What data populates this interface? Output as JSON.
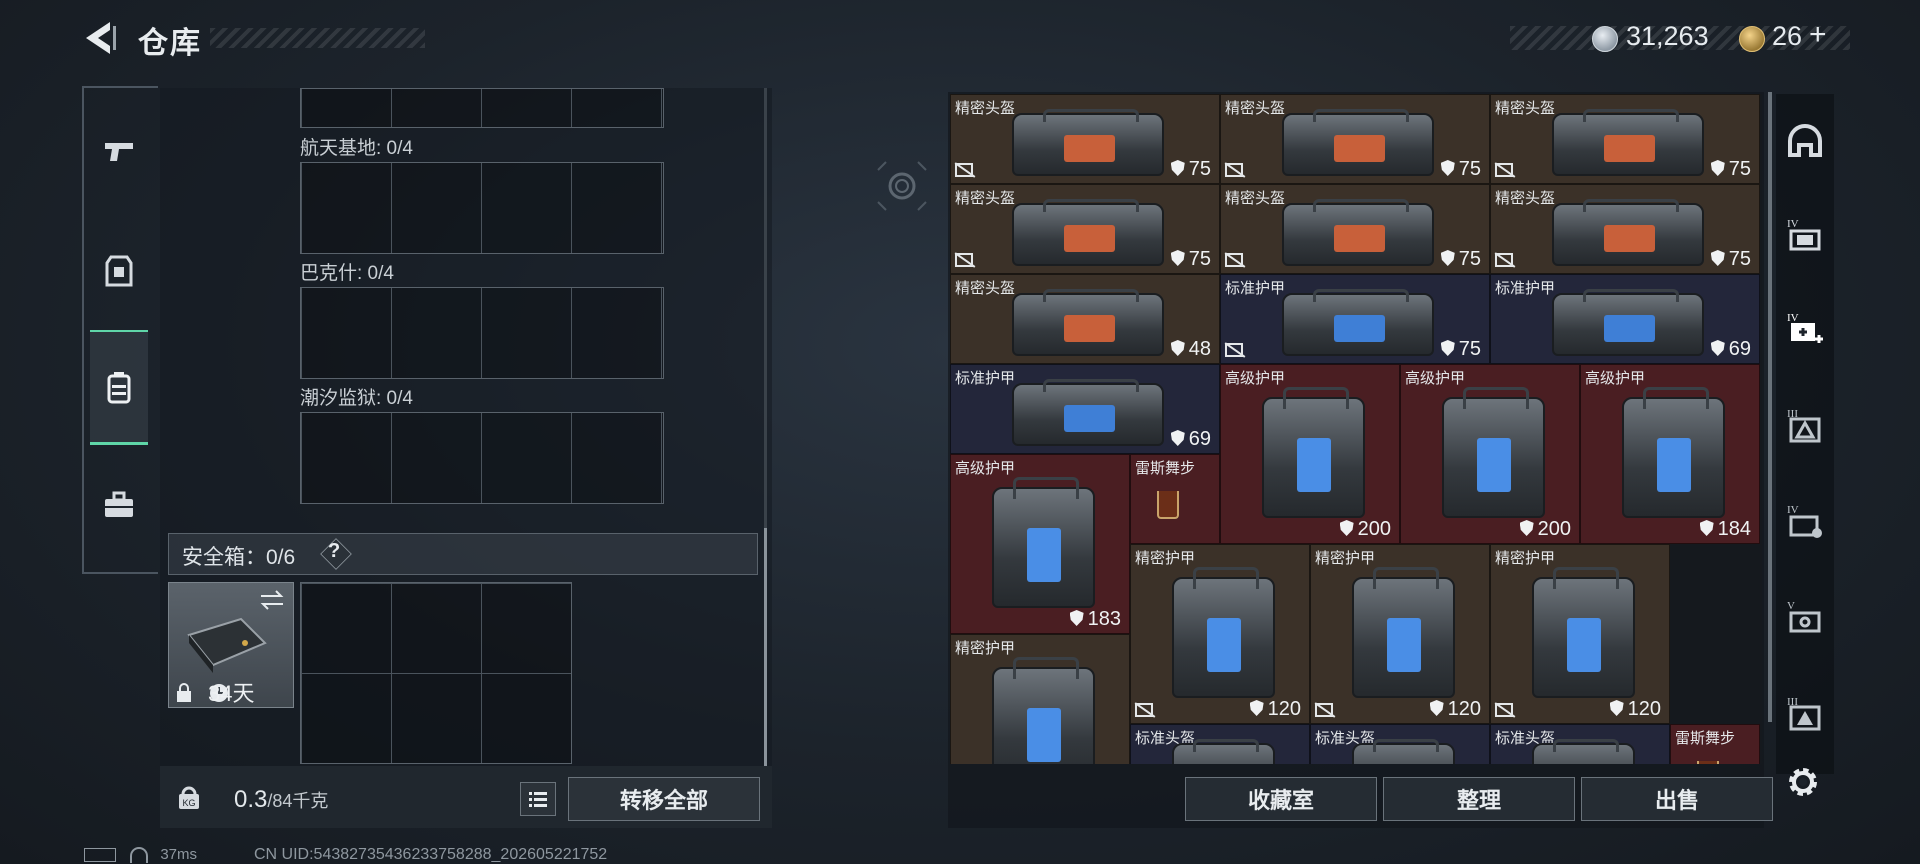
{
  "header": {
    "title": "仓库",
    "currency1": "31,263",
    "currency2": "26",
    "plus": "+"
  },
  "left_tabs": [
    {
      "icon": "pistol-icon"
    },
    {
      "icon": "armor-vest-icon"
    },
    {
      "icon": "backpack-icon",
      "active": true
    },
    {
      "icon": "toolbox-icon"
    }
  ],
  "storage_sections": [
    {
      "label": "航天基地: 0/4"
    },
    {
      "label": "巴克什: 0/4"
    },
    {
      "label": "潮汐监狱: 0/4"
    }
  ],
  "safe_box": {
    "label": "安全箱：0/6",
    "help": "?",
    "days": "34天"
  },
  "bottom_left": {
    "weight": "0.3",
    "weight_max": "/84千克",
    "transfer_label": "转移全部"
  },
  "status": {
    "ping": "37ms",
    "uid": "CN UID:5438273543623375828​8_202605221752"
  },
  "inventory": [
    {
      "name": "精密头盔",
      "durability": "75",
      "bg": "brown",
      "win": "#c8603a",
      "no_repair": true
    },
    {
      "name": "精密头盔",
      "durability": "75",
      "bg": "brown",
      "win": "#c8603a",
      "no_repair": true
    },
    {
      "name": "精密头盔",
      "durability": "75",
      "bg": "brown",
      "win": "#c8603a",
      "no_repair": true
    },
    {
      "name": "精密头盔",
      "durability": "75",
      "bg": "brown",
      "win": "#c8603a",
      "no_repair": true
    },
    {
      "name": "精密头盔",
      "durability": "75",
      "bg": "brown",
      "win": "#c8603a",
      "no_repair": true
    },
    {
      "name": "精密头盔",
      "durability": "75",
      "bg": "brown",
      "win": "#c8603a",
      "no_repair": true
    },
    {
      "name": "精密头盔",
      "durability": "48",
      "bg": "brown",
      "win": "#c8603a",
      "no_repair": false
    },
    {
      "name": "标准护甲",
      "durability": "75",
      "bg": "navy",
      "win": "#3f7fd6",
      "no_repair": true
    },
    {
      "name": "标准护甲",
      "durability": "69",
      "bg": "navy",
      "win": "#3f7fd6",
      "no_repair": false
    },
    {
      "name": "标准护甲",
      "durability": "69",
      "bg": "navy",
      "win": "#3f7fd6",
      "no_repair": false
    },
    {
      "name": "高级护甲",
      "durability": "200",
      "bg": "red",
      "win": "#4a8ee6",
      "no_repair": false
    },
    {
      "name": "高级护甲",
      "durability": "200",
      "bg": "red",
      "win": "#4a8ee6",
      "no_repair": false
    },
    {
      "name": "高级护甲",
      "durability": "184",
      "bg": "red",
      "win": "#4a8ee6",
      "no_repair": false
    },
    {
      "name": "高级护甲",
      "durability": "183",
      "bg": "red",
      "win": "#4a8ee6",
      "no_repair": false
    },
    {
      "name": "雷斯舞步",
      "durability": "",
      "bg": "red",
      "win": "",
      "no_repair": false
    },
    {
      "name": "精密护甲",
      "durability": "120",
      "bg": "brown",
      "win": "#4a8ee6",
      "no_repair": true
    },
    {
      "name": "精密护甲",
      "durability": "120",
      "bg": "brown",
      "win": "#4a8ee6",
      "no_repair": true
    },
    {
      "name": "精密护甲",
      "durability": "120",
      "bg": "brown",
      "win": "#4a8ee6",
      "no_repair": true
    },
    {
      "name": "精密护甲",
      "durability": "",
      "bg": "brown",
      "win": "#4a8ee6",
      "no_repair": false
    },
    {
      "name": "标准头盔",
      "durability": "",
      "bg": "navy",
      "win": "#3f7fd6",
      "no_repair": false
    },
    {
      "name": "标准头盔",
      "durability": "",
      "bg": "navy",
      "win": "#3f7fd6",
      "no_repair": false
    },
    {
      "name": "标准头盔",
      "durability": "",
      "bg": "navy",
      "win": "#3f7fd6",
      "no_repair": false
    },
    {
      "name": "雷斯舞步",
      "durability": "",
      "bg": "red",
      "win": "",
      "no_repair": false
    }
  ],
  "bottom_right": {
    "collection": "收藏室",
    "sort": "整理",
    "sell": "出售"
  },
  "right_tabs": [
    {
      "icon": "helmet-icon"
    },
    {
      "icon": "tier-iv-chest-rig-icon",
      "tier": "IV"
    },
    {
      "icon": "tier-iv-medkit-add-icon",
      "tier": "IV"
    },
    {
      "icon": "tier-iii-armor-icon",
      "tier": "III"
    },
    {
      "icon": "tier-iv-vest-icon",
      "tier": "IV"
    },
    {
      "icon": "tier-v-bag-icon",
      "tier": "V"
    },
    {
      "icon": "tier-iii-plate-icon",
      "tier": "III"
    }
  ],
  "colors": {
    "accent": "#5fd6a8",
    "brown": "#3b3128",
    "navy": "#23263a",
    "red": "#4a1e22"
  }
}
